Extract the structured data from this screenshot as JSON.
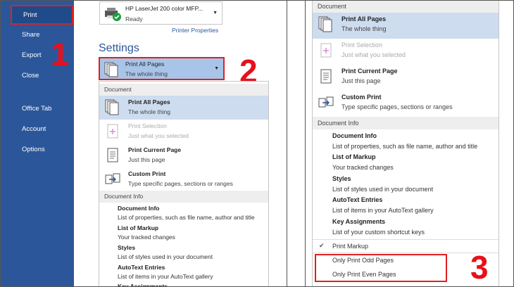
{
  "sidebar": {
    "items": [
      {
        "label": "Print"
      },
      {
        "label": "Share"
      },
      {
        "label": "Export"
      },
      {
        "label": "Close"
      },
      {
        "label": "Office Tab"
      },
      {
        "label": "Account"
      },
      {
        "label": "Options"
      }
    ]
  },
  "steps": {
    "one": "1",
    "two": "2",
    "three": "3"
  },
  "printer": {
    "name": "HP LaserJet 200 color MFP...",
    "status": "Ready",
    "properties_link": "Printer Properties"
  },
  "settings": {
    "heading": "Settings",
    "selected_title": "Print All Pages",
    "selected_sub": "The whole thing"
  },
  "menu": {
    "document_header": "Document",
    "options": [
      {
        "title": "Print All Pages",
        "sub": "The whole thing"
      },
      {
        "title": "Print Selection",
        "sub": "Just what you selected"
      },
      {
        "title": "Print Current Page",
        "sub": "Just this page"
      },
      {
        "title": "Custom Print",
        "sub": "Type specific pages, sections or ranges"
      }
    ],
    "info_header": "Document Info",
    "info": [
      {
        "title": "Document Info",
        "sub": "List of properties, such as file name, author and title"
      },
      {
        "title": "List of Markup",
        "sub": "Your tracked changes"
      },
      {
        "title": "Styles",
        "sub": "List of styles used in your document"
      },
      {
        "title": "AutoText Entries",
        "sub": "List of items in your AutoText gallery"
      },
      {
        "title": "Key Assignments",
        "sub": "List of your custom shortcut keys"
      }
    ],
    "print_markup": "Print Markup",
    "check_mark": "✔",
    "odd_pages": "Only Print Odd Pages",
    "even_pages": "Only Print Even Pages"
  },
  "colors": {
    "accent": "#2b579a",
    "highlight": "#e02020",
    "selected": "#cddcef"
  }
}
